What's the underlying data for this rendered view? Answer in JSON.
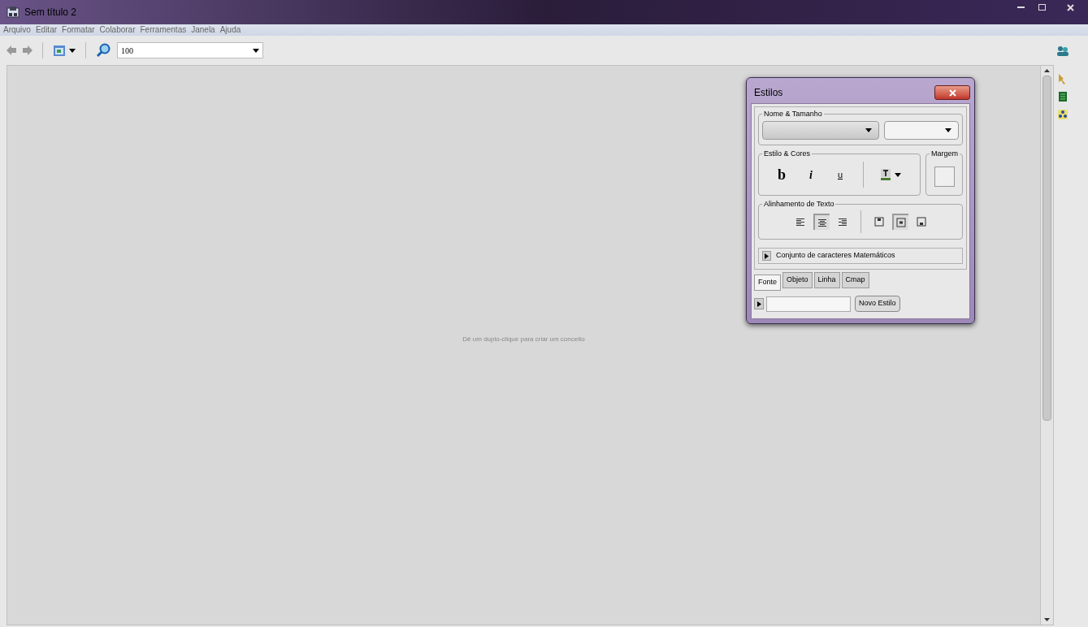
{
  "window": {
    "title": "Sem título 2"
  },
  "menu": [
    "Arquivo",
    "Editar",
    "Formatar",
    "Colaborar",
    "Ferramentas",
    "Janela",
    "Ajuda"
  ],
  "toolbar": {
    "zoom": "100"
  },
  "canvas": {
    "hint": "Dê um duplo-clique para criar um conceito"
  },
  "styles": {
    "title": "Estilos",
    "name_size_label": "Nome & Tamanho",
    "style_colors_label": "Estilo & Cores",
    "style_buttons": [
      {
        "kind": "bold",
        "label": "b"
      },
      {
        "kind": "italic",
        "label": "i"
      },
      {
        "kind": "underline",
        "label": "u"
      }
    ],
    "margin_label": "Margem",
    "alignment_label": "Alinhamento de Texto",
    "align_buttons": [
      {
        "kind": "h-left",
        "selected": false
      },
      {
        "kind": "h-center",
        "selected": true
      },
      {
        "kind": "h-right",
        "selected": false
      },
      {
        "kind": "v-top",
        "selected": false
      },
      {
        "kind": "v-middle",
        "selected": true
      },
      {
        "kind": "v-bottom",
        "selected": false
      }
    ],
    "math_charset": "Conjunto de caracteres Matemáticos",
    "tabs": [
      {
        "label": "Fonte",
        "selected": true
      },
      {
        "label": "Objeto",
        "selected": false
      },
      {
        "label": "Linha",
        "selected": false
      },
      {
        "label": "Cmap",
        "selected": false
      }
    ],
    "new_style_button": "Novo Estilo"
  }
}
